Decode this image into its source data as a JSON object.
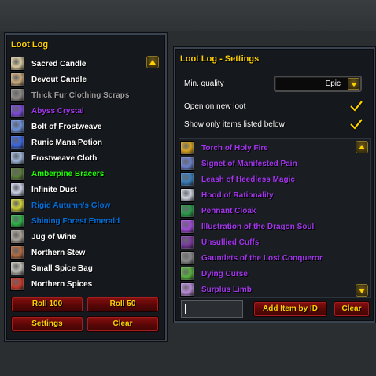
{
  "loot_log": {
    "title": "Loot Log",
    "items": [
      {
        "name": "Sacred Candle",
        "color": "#ffffff",
        "icon": "candle-icon",
        "icon_color": "#d9c9a0"
      },
      {
        "name": "Devout Candle",
        "color": "#ffffff",
        "icon": "candle-icon",
        "icon_color": "#c8a87a"
      },
      {
        "name": "Thick Fur Clothing Scraps",
        "color": "#9d9d9d",
        "icon": "fur-scraps-icon",
        "icon_color": "#8d8a86"
      },
      {
        "name": "Abyss Crystal",
        "color": "#a335ee",
        "icon": "crystal-icon",
        "icon_color": "#7a4ad6"
      },
      {
        "name": "Bolt of Frostweave",
        "color": "#ffffff",
        "icon": "cloth-bolt-icon",
        "icon_color": "#6d8fd8"
      },
      {
        "name": "Runic Mana Potion",
        "color": "#ffffff",
        "icon": "potion-icon",
        "icon_color": "#3a66e0"
      },
      {
        "name": "Frostweave Cloth",
        "color": "#ffffff",
        "icon": "cloth-icon",
        "icon_color": "#9db4d8"
      },
      {
        "name": "Amberpine Bracers",
        "color": "#1eff00",
        "icon": "bracers-icon",
        "icon_color": "#5a7b3a"
      },
      {
        "name": "Infinite Dust",
        "color": "#ffffff",
        "icon": "dust-icon",
        "icon_color": "#c9cfe6"
      },
      {
        "name": "Rigid Autumn's Glow",
        "color": "#0070dd",
        "icon": "gem-icon",
        "icon_color": "#cfd23a"
      },
      {
        "name": "Shining Forest Emerald",
        "color": "#0070dd",
        "icon": "gem-icon",
        "icon_color": "#2fb34a"
      },
      {
        "name": "Jug of Wine",
        "color": "#ffffff",
        "icon": "jug-icon",
        "icon_color": "#a9a49a"
      },
      {
        "name": "Northern Stew",
        "color": "#ffffff",
        "icon": "stew-icon",
        "icon_color": "#b06a42"
      },
      {
        "name": "Small Spice Bag",
        "color": "#ffffff",
        "icon": "spice-bag-icon",
        "icon_color": "#c0bfb8"
      },
      {
        "name": "Northern Spices",
        "color": "#ffffff",
        "icon": "spices-icon",
        "icon_color": "#c83a2a"
      }
    ],
    "buttons": {
      "roll100": "Roll 100",
      "roll50": "Roll 50",
      "settings": "Settings",
      "clear": "Clear"
    }
  },
  "settings": {
    "title": "Loot Log - Settings",
    "min_quality_label": "Min. quality",
    "min_quality_value": "Epic",
    "open_on_new_loot_label": "Open on new loot",
    "open_on_new_loot_checked": true,
    "show_only_listed_label": "Show only items listed below",
    "show_only_listed_checked": true,
    "items": [
      {
        "name": "Torch of Holy Fire",
        "color": "#a335ee",
        "icon": "torch-icon",
        "icon_color": "#d8a420"
      },
      {
        "name": "Signet of Manifested Pain",
        "color": "#a335ee",
        "icon": "ring-icon",
        "icon_color": "#6a7fc8"
      },
      {
        "name": "Leash of Heedless Magic",
        "color": "#a335ee",
        "icon": "leash-icon",
        "icon_color": "#3a7fc0"
      },
      {
        "name": "Hood of Rationality",
        "color": "#a335ee",
        "icon": "hood-icon",
        "icon_color": "#d0d4e0"
      },
      {
        "name": "Pennant Cloak",
        "color": "#a335ee",
        "icon": "cloak-icon",
        "icon_color": "#2a9a4a"
      },
      {
        "name": "Illustration of the Dragon Soul",
        "color": "#a335ee",
        "icon": "book-icon",
        "icon_color": "#a04ad8"
      },
      {
        "name": "Unsullied Cuffs",
        "color": "#a335ee",
        "icon": "cuffs-icon",
        "icon_color": "#7a3aa0"
      },
      {
        "name": "Gauntlets of the Lost Conqueror",
        "color": "#a335ee",
        "icon": "gauntlets-icon",
        "icon_color": "#8a8a8a"
      },
      {
        "name": "Dying Curse",
        "color": "#a335ee",
        "icon": "curse-icon",
        "icon_color": "#5ab040"
      },
      {
        "name": "Surplus Limb",
        "color": "#a335ee",
        "icon": "limb-icon",
        "icon_color": "#b88ad8"
      }
    ],
    "id_input_value": "",
    "buttons": {
      "add_item": "Add Item by ID",
      "clear": "Clear"
    }
  }
}
